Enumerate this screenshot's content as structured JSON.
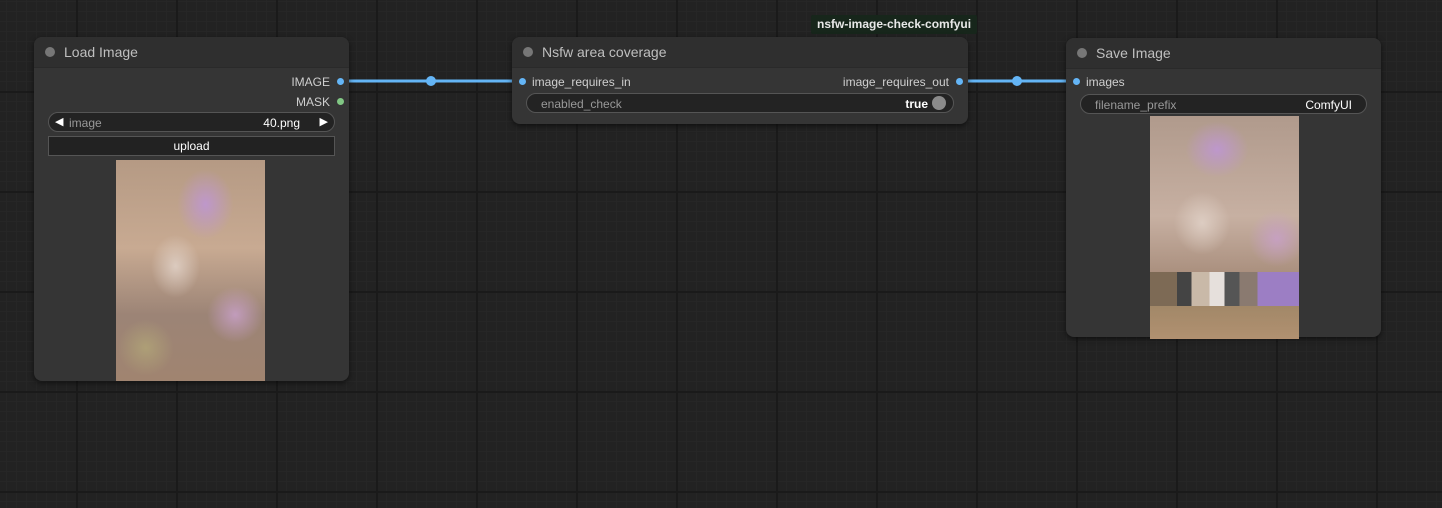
{
  "group_badge": "nsfw-image-check-comfyui",
  "nodes": {
    "load_image": {
      "title": "Load Image",
      "outputs": [
        "IMAGE",
        "MASK"
      ],
      "image_widget": {
        "label": "image",
        "value": "40.png"
      },
      "upload_button": "upload"
    },
    "nsfw": {
      "title": "Nsfw area coverage",
      "input": "image_requires_in",
      "output": "image_requires_out",
      "toggle": {
        "label": "enabled_check",
        "value": "true"
      }
    },
    "save_image": {
      "title": "Save Image",
      "input": "images",
      "prefix_widget": {
        "label": "filename_prefix",
        "value": "ComfyUI"
      }
    }
  },
  "colors": {
    "link": "#64b5f6",
    "image_slot": "#64b5f6",
    "mask_slot": "#81c784",
    "canvas": "#222222",
    "node_body": "#353535"
  },
  "icons": {
    "combo_left": "◀",
    "combo_right": "▶"
  }
}
